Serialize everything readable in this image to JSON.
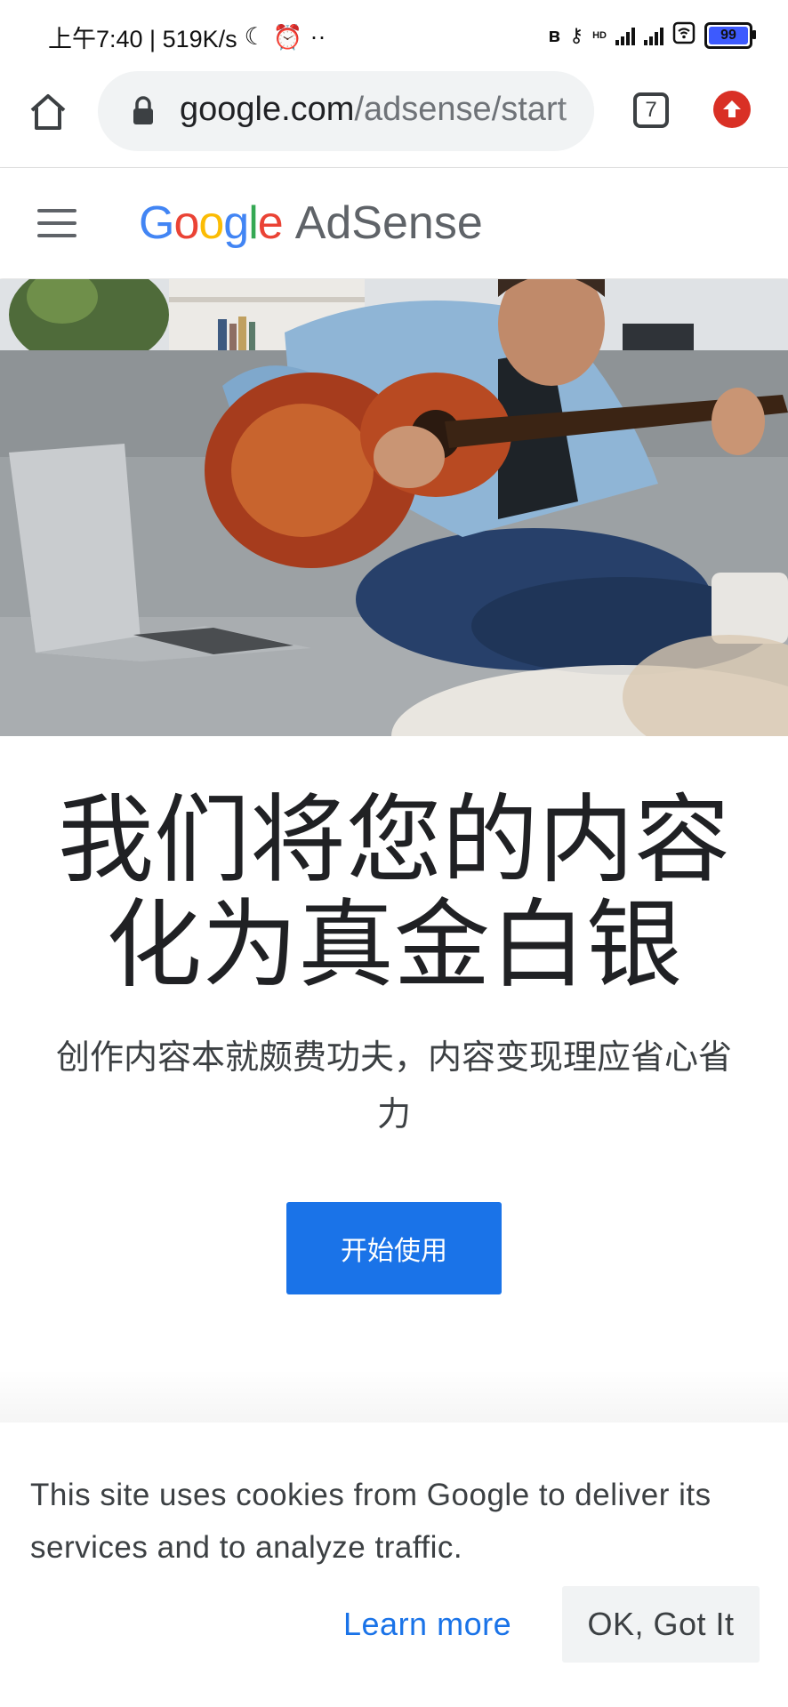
{
  "status_bar": {
    "time_info": "上午7:40 | 519K/s",
    "network_label": "HD",
    "battery": "99"
  },
  "browser": {
    "url_host": "google.com",
    "url_path": "/adsense/start",
    "tab_count": "7"
  },
  "site": {
    "logo_google": "Google",
    "logo_product": "AdSense"
  },
  "hero": {
    "image_subject": "man-playing-guitar-on-sofa"
  },
  "main": {
    "headline_line1": "我们将您的内容",
    "headline_line2": "化为真金白银",
    "subhead": "创作内容本就颇费功夫，内容变现理应省心省力",
    "cta_label": "开始使用"
  },
  "cookie_bar": {
    "message": "This site uses cookies from Google to deliver its services and to analyze traffic.",
    "learn_more_label": "Learn more",
    "ok_label": "OK, Got It"
  },
  "colors": {
    "google_blue": "#4285F4",
    "google_red": "#EA4335",
    "google_yellow": "#FBBC05",
    "google_green": "#34A853",
    "cta_blue": "#1a73e8"
  }
}
